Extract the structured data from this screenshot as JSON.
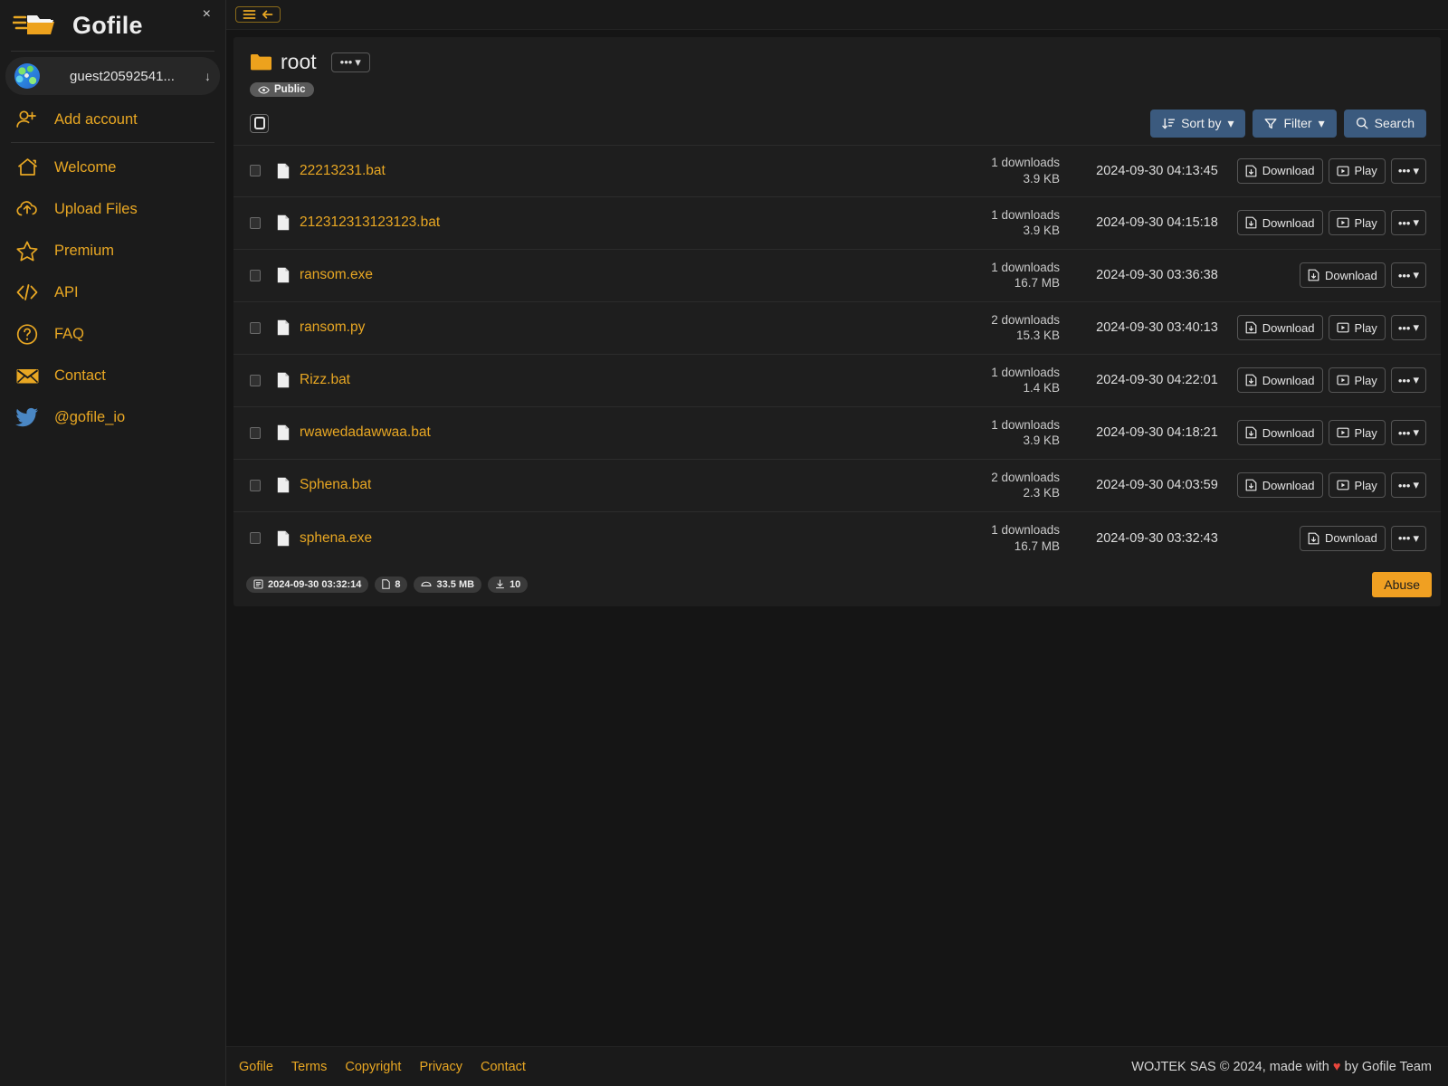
{
  "window": {
    "close_label": "×"
  },
  "sidebar": {
    "brand": "Gofile",
    "logo_icon": "gofile-folder-logo",
    "account": {
      "name": "guest20592541...",
      "avatar_icon": "identicon-avatar",
      "caret_icon": "arrow-down-icon"
    },
    "add_account": {
      "label": "Add account",
      "icon": "user-plus-icon"
    },
    "items": [
      {
        "label": "Welcome",
        "icon": "home-icon"
      },
      {
        "label": "Upload Files",
        "icon": "cloud-upload-icon"
      },
      {
        "label": "Premium",
        "icon": "star-icon"
      },
      {
        "label": "API",
        "icon": "code-icon"
      },
      {
        "label": "FAQ",
        "icon": "question-circle-icon"
      },
      {
        "label": "Contact",
        "icon": "envelope-icon"
      },
      {
        "label": "@gofile_io",
        "icon": "twitter-bird-icon"
      }
    ]
  },
  "topbar": {
    "menu_button": {
      "hamburger_icon": "hamburger-icon",
      "back_icon": "arrow-left-icon"
    }
  },
  "content": {
    "folder_name": "root",
    "folder_icon": "folder-icon",
    "folder_menu_label": "•••",
    "visibility_badge": {
      "label": "Public",
      "icon": "eye-icon"
    },
    "toolbar": {
      "sort_label": "Sort by",
      "sort_icon": "sort-icon",
      "filter_label": "Filter",
      "filter_icon": "funnel-icon",
      "search_label": "Search",
      "search_icon": "magnifier-icon",
      "caret": "▾"
    },
    "row_actions": {
      "download_label": "Download",
      "download_icon": "file-download-icon",
      "play_label": "Play",
      "play_icon": "play-box-icon",
      "more_label": "•••"
    },
    "files": [
      {
        "name": "22213231.bat",
        "downloads": "1 downloads",
        "size": "3.9 KB",
        "date": "2024-09-30 04:13:45",
        "has_play": true
      },
      {
        "name": "212312313123123.bat",
        "downloads": "1 downloads",
        "size": "3.9 KB",
        "date": "2024-09-30 04:15:18",
        "has_play": true
      },
      {
        "name": "ransom.exe",
        "downloads": "1 downloads",
        "size": "16.7 MB",
        "date": "2024-09-30 03:36:38",
        "has_play": false
      },
      {
        "name": "ransom.py",
        "downloads": "2 downloads",
        "size": "15.3 KB",
        "date": "2024-09-30 03:40:13",
        "has_play": true
      },
      {
        "name": "Rizz.bat",
        "downloads": "1 downloads",
        "size": "1.4 KB",
        "date": "2024-09-30 04:22:01",
        "has_play": true
      },
      {
        "name": "rwawedadawwaa.bat",
        "downloads": "1 downloads",
        "size": "3.9 KB",
        "date": "2024-09-30 04:18:21",
        "has_play": true
      },
      {
        "name": "Sphena.bat",
        "downloads": "2 downloads",
        "size": "2.3 KB",
        "date": "2024-09-30 04:03:59",
        "has_play": true
      },
      {
        "name": "sphena.exe",
        "downloads": "1 downloads",
        "size": "16.7 MB",
        "date": "2024-09-30 03:32:43",
        "has_play": false
      }
    ],
    "summary_chips": [
      {
        "label": "2024-09-30 03:32:14",
        "icon": "calendar-icon"
      },
      {
        "label": "8",
        "icon": "file-count-icon"
      },
      {
        "label": "33.5 MB",
        "icon": "disk-icon"
      },
      {
        "label": "10",
        "icon": "download-count-icon"
      }
    ],
    "abuse_button": "Abuse"
  },
  "footer": {
    "links": [
      "Gofile",
      "Terms",
      "Copyright",
      "Privacy",
      "Contact"
    ],
    "copyright_prefix": "WOJTEK SAS © 2024, made with",
    "heart": "♥",
    "copyright_suffix": "by Gofile Team"
  },
  "colors": {
    "accent": "#e8a723",
    "button_blue": "#3b5a7e",
    "abuse_orange": "#f0a022",
    "bg": "#151515",
    "panel": "#1e1e1e"
  }
}
